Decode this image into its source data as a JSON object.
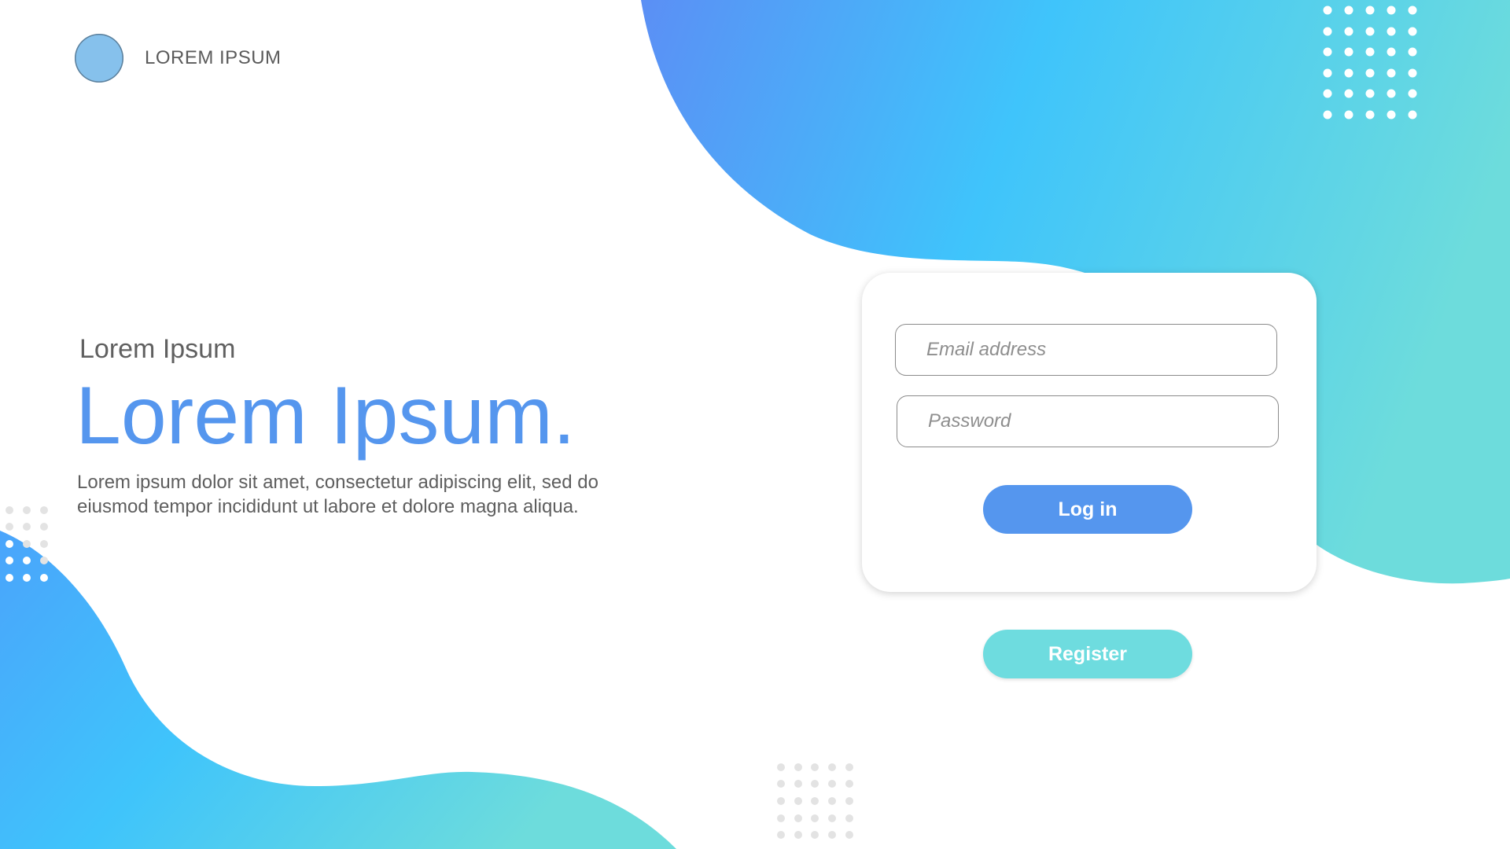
{
  "header": {
    "brand": "LOREM IPSUM"
  },
  "hero": {
    "eyebrow": "Lorem Ipsum",
    "headline": "Lorem Ipsum.",
    "lead": "Lorem ipsum dolor sit amet, consectetur adipiscing elit, sed do eiusmod tempor incididunt ut labore et dolore magna aliqua."
  },
  "login": {
    "email_placeholder": "Email address",
    "password_placeholder": "Password",
    "login_label": "Log in",
    "register_label": "Register"
  },
  "colors": {
    "accent_blue": "#5596ee",
    "accent_teal": "#6edcdf",
    "logo_circle": "#86c1ec",
    "gradient_start": "#5b8ff5",
    "gradient_mid": "#3fc4fb",
    "gradient_end": "#6ddcdc"
  },
  "icons": {
    "logo": "circle-logo-icon",
    "decor": "dot-grid-pattern"
  }
}
